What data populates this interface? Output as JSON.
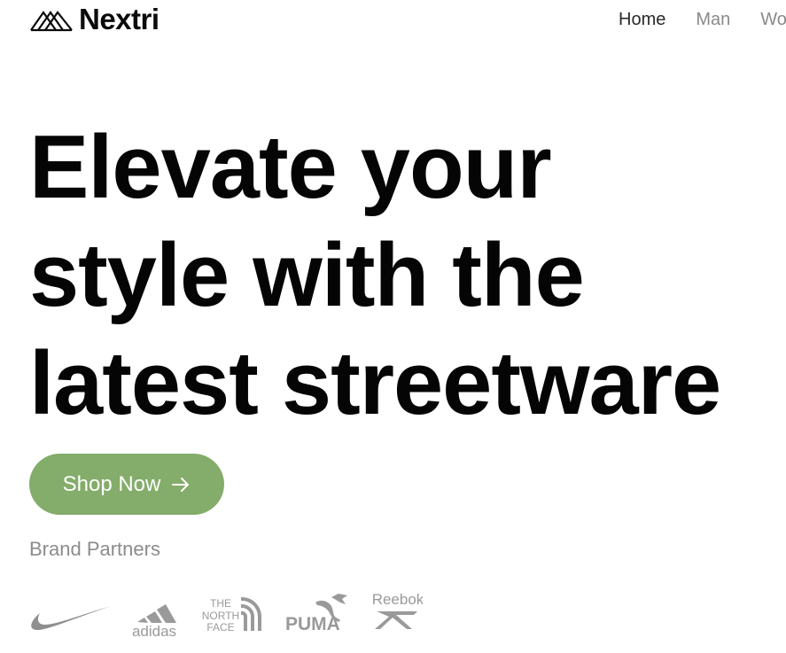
{
  "header": {
    "brand_name": "Nextri",
    "nav": [
      {
        "label": "Home",
        "active": true
      },
      {
        "label": "Man",
        "active": false
      },
      {
        "label": "Women",
        "active": false
      }
    ]
  },
  "hero": {
    "title_lines": [
      "Elevate your",
      "style with the",
      "latest streetware"
    ],
    "cta_label": "Shop Now",
    "cta_icon": "arrow-right-icon"
  },
  "partners": {
    "label": "Brand Partners",
    "brands": [
      {
        "name": "Nike",
        "icon": "nike-logo"
      },
      {
        "name": "adidas",
        "icon": "adidas-logo"
      },
      {
        "name": "THE NORTH FACE",
        "icon": "north-face-logo",
        "lines": [
          "THE",
          "NORTH",
          "FACE"
        ]
      },
      {
        "name": "PUMA",
        "icon": "puma-logo"
      },
      {
        "name": "Reebok",
        "icon": "reebok-logo"
      }
    ]
  },
  "colors": {
    "accent": "#84ac6a",
    "text": "#050505",
    "muted": "#8c8c8c",
    "logo_gray": "#9a9a9a"
  }
}
